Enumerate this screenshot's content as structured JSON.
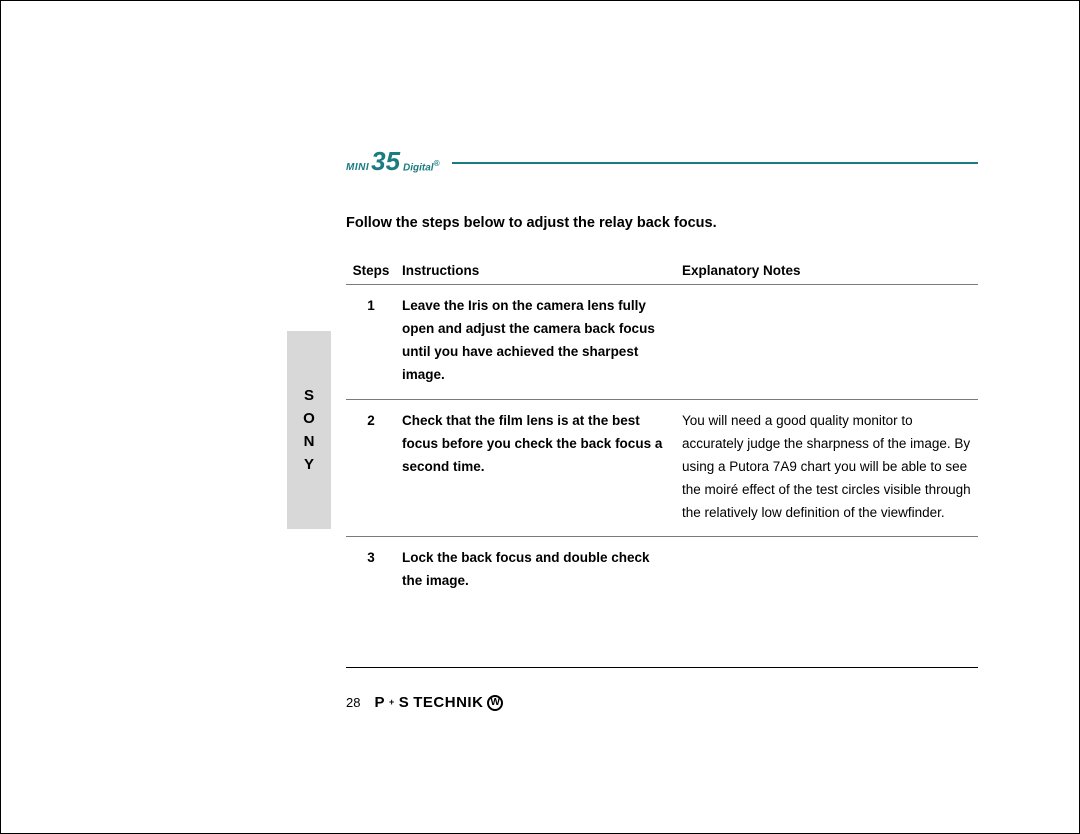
{
  "sidebar": {
    "letters": [
      "S",
      "O",
      "N",
      "Y"
    ]
  },
  "logo": {
    "mini": "MINI",
    "num": "35",
    "digital": "Digital",
    "reg": "®"
  },
  "intro": "Follow the steps below to adjust the relay back focus.",
  "table": {
    "headers": {
      "steps": "Steps",
      "instructions": "Instructions",
      "notes": "Explanatory Notes"
    },
    "rows": [
      {
        "n": "1",
        "instr": "Leave the Iris on the camera lens fully open and adjust the camera back focus until you have achieved the sharpest image.",
        "notes": ""
      },
      {
        "n": "2",
        "instr": "Check that the film lens is at the best focus before you check the back focus a second time.",
        "notes": "You will need a good quality monitor to accurately judge the sharpness of the image. By using a Putora 7A9 chart you will be able to see the moiré effect of the test circles visible through the relatively low definition of the viewfinder."
      },
      {
        "n": "3",
        "instr": "Lock the back focus and double check the image.",
        "notes": ""
      }
    ]
  },
  "footer": {
    "page": "28",
    "brand_p": "P",
    "brand_plus": "+",
    "brand_s": "S",
    "brand_tech": "TECHNIK",
    "brand_mark": "W"
  }
}
